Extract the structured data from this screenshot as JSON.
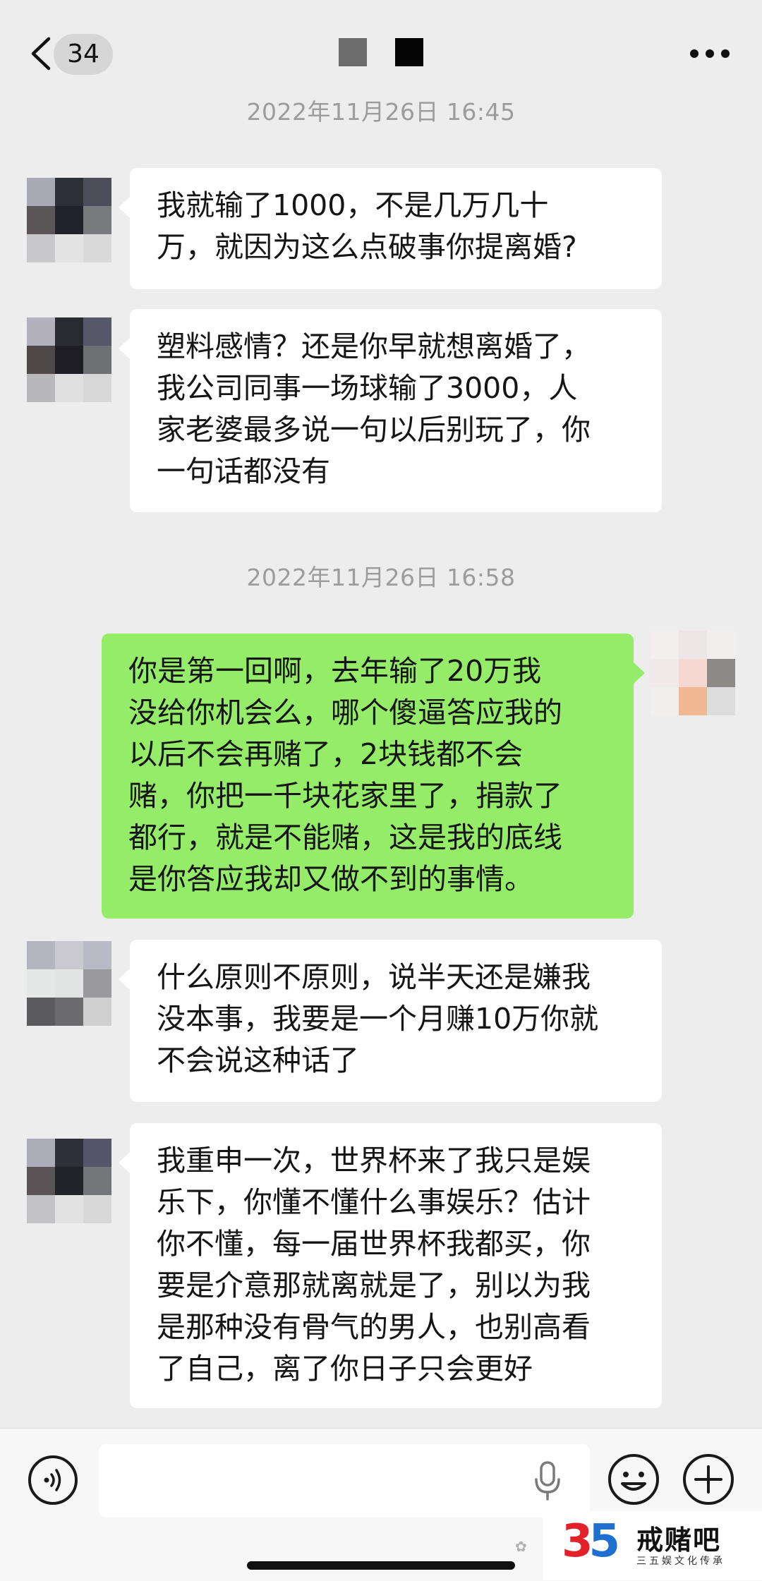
{
  "header": {
    "unread_count": "34"
  },
  "timestamps": [
    "2022年11月26日 16:45",
    "2022年11月26日 16:58"
  ],
  "messages": [
    {
      "side": "left",
      "text": "我就输了1000，不是几万几十\n万，就因为这么点破事你提离婚?"
    },
    {
      "side": "left",
      "text": "塑料感情？还是你早就想离婚了，\n我公司同事一场球输了3000，人\n家老婆最多说一句以后别玩了，你\n一句话都没有"
    },
    {
      "side": "right",
      "text": "你是第一回啊，去年输了20万我\n没给你机会么，哪个傻逼答应我的\n以后不会再赌了，2块钱都不会\n赌，你把一千块花家里了，捐款了\n都行，就是不能赌，这是我的底线\n是你答应我却又做不到的事情。"
    },
    {
      "side": "left",
      "text": "什么原则不原则，说半天还是嫌我\n没本事，我要是一个月赚10万你就\n不会说这种话了"
    },
    {
      "side": "left",
      "text": "我重申一次，世界杯来了我只是娱\n乐下，你懂不懂什么事娱乐？估计\n你不懂，每一届世界杯我都买，你\n要是介意那就离就是了，别以为我\n是那种没有骨气的男人，也别高看\n了自己，离了你日子只会更好"
    }
  ],
  "logo": {
    "number_a": "3",
    "number_b": "5",
    "name": "戒赌吧",
    "tagline": "三五娱文化传承"
  },
  "colors": {
    "background": "#ededed",
    "bubble_left": "#ffffff",
    "bubble_right": "#95ec69",
    "timestamp": "#9c9c9c"
  }
}
